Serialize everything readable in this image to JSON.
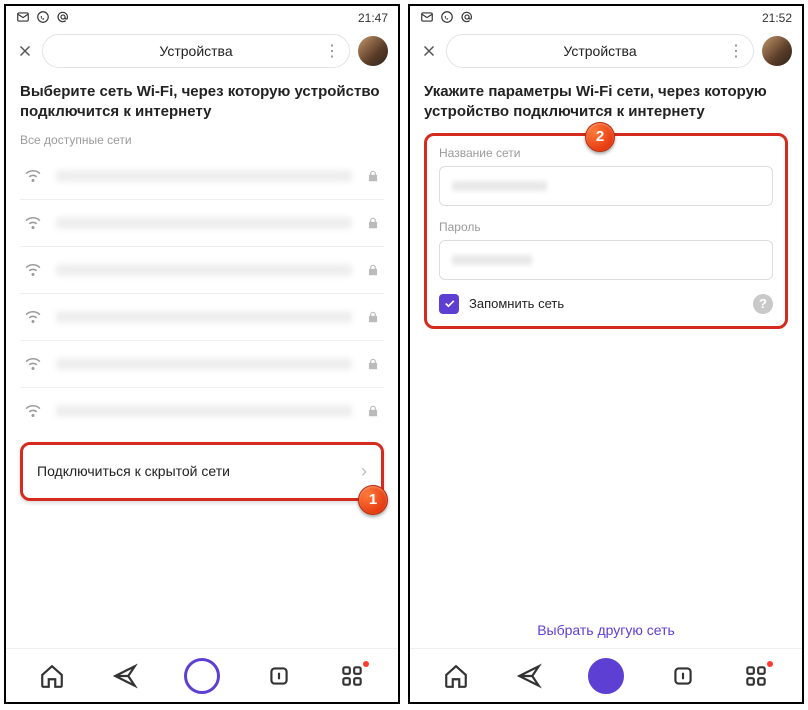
{
  "screen1": {
    "time": "21:47",
    "title": "Устройства",
    "heading": "Выберите сеть Wi-Fi, через которую устройство подключится к интернету",
    "subhead": "Все доступные сети",
    "hidden_network_label": "Подключиться к скрытой сети",
    "badge": "1"
  },
  "screen2": {
    "time": "21:52",
    "title": "Устройства",
    "heading": "Укажите параметры Wi-Fi сети, через которую устройство подключится к интернету",
    "ssid_label": "Название сети",
    "password_label": "Пароль",
    "remember_label": "Запомнить сеть",
    "other_network_link": "Выбрать другую сеть",
    "badge": "2"
  }
}
